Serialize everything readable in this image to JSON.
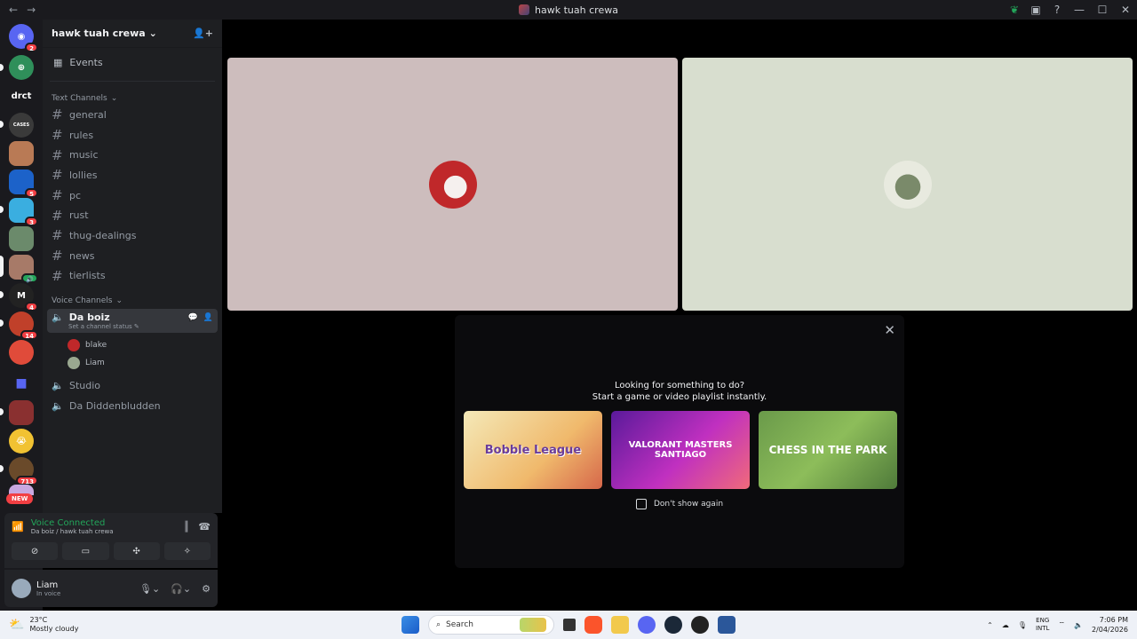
{
  "window": {
    "title": "hawk tuah crewa",
    "back": "←",
    "forward": "→",
    "win_min": "—",
    "win_max": "☐",
    "win_close": "✕"
  },
  "rail": {
    "servers": [
      {
        "label": "",
        "badge": "2",
        "color": "#5865f2"
      },
      {
        "label": "",
        "badge": "",
        "color": "#2f8f5a"
      },
      {
        "label": "drct",
        "badge": "",
        "color": "#1a1a1e"
      },
      {
        "label": "CASES",
        "badge": "",
        "color": "#3a3a3a"
      },
      {
        "label": "",
        "badge": "",
        "color": "#b97a55"
      },
      {
        "label": "",
        "badge": "5",
        "color": "#1c62c9"
      },
      {
        "label": "",
        "badge": "3",
        "color": "#3aaee0"
      },
      {
        "label": "",
        "badge": "",
        "color": "#6b8a6b"
      },
      {
        "label": "",
        "badge": "",
        "color": "#a77a68"
      },
      {
        "label": "M",
        "badge": "4",
        "color": "#222"
      },
      {
        "label": "",
        "badge": "14",
        "color": "#c0402a"
      },
      {
        "label": "",
        "badge": "",
        "color": "#e04b3a"
      },
      {
        "label": "",
        "badge": "",
        "color": "#5865f2"
      },
      {
        "label": "",
        "badge": "",
        "color": "#8a3030"
      },
      {
        "label": "",
        "badge": "",
        "color": "#f1c232"
      },
      {
        "label": "",
        "badge": "713",
        "color": "#6a4a2a"
      },
      {
        "label": "",
        "badge": "",
        "color": "#c9a8e0"
      }
    ],
    "new_badge": "NEW"
  },
  "guild": {
    "name": "hawk tuah crewa",
    "events_label": "Events",
    "text_category": "Text Channels",
    "text_channels": [
      "general",
      "rules",
      "music",
      "lollies",
      "pc",
      "rust",
      "thug-dealings",
      "news",
      "tierlists"
    ],
    "voice_category": "Voice Channels",
    "active_voice": {
      "name": "Da boiz",
      "status_prompt": "Set a channel status",
      "members": [
        {
          "name": "blake",
          "color": "#c0282a"
        },
        {
          "name": "Liam",
          "color": "#9aa890"
        }
      ]
    },
    "other_voice": [
      "Studio",
      "Da Diddenbludden"
    ]
  },
  "voice_panel": {
    "title": "Voice Connected",
    "subtitle": "Da boiz / hawk tuah crewa"
  },
  "user_panel": {
    "name": "Liam",
    "status": "In voice"
  },
  "stage": {
    "tile_left_color": "#cdbdbd",
    "tile_right_color": "#d8decf",
    "activity": {
      "line1": "Looking for something to do?",
      "line2": "Start a game or video playlist instantly.",
      "cards": [
        "Bobble League",
        "VALORANT MASTERS SANTIAGO",
        "CHESS IN THE PARK"
      ],
      "dont_show": "Don't show again"
    }
  },
  "taskbar": {
    "temp": "23°C",
    "condition": "Mostly cloudy",
    "search_placeholder": "Search",
    "lang1": "ENG",
    "lang2": "INTL",
    "time": "7:06 PM",
    "date": "2/04/2026"
  }
}
